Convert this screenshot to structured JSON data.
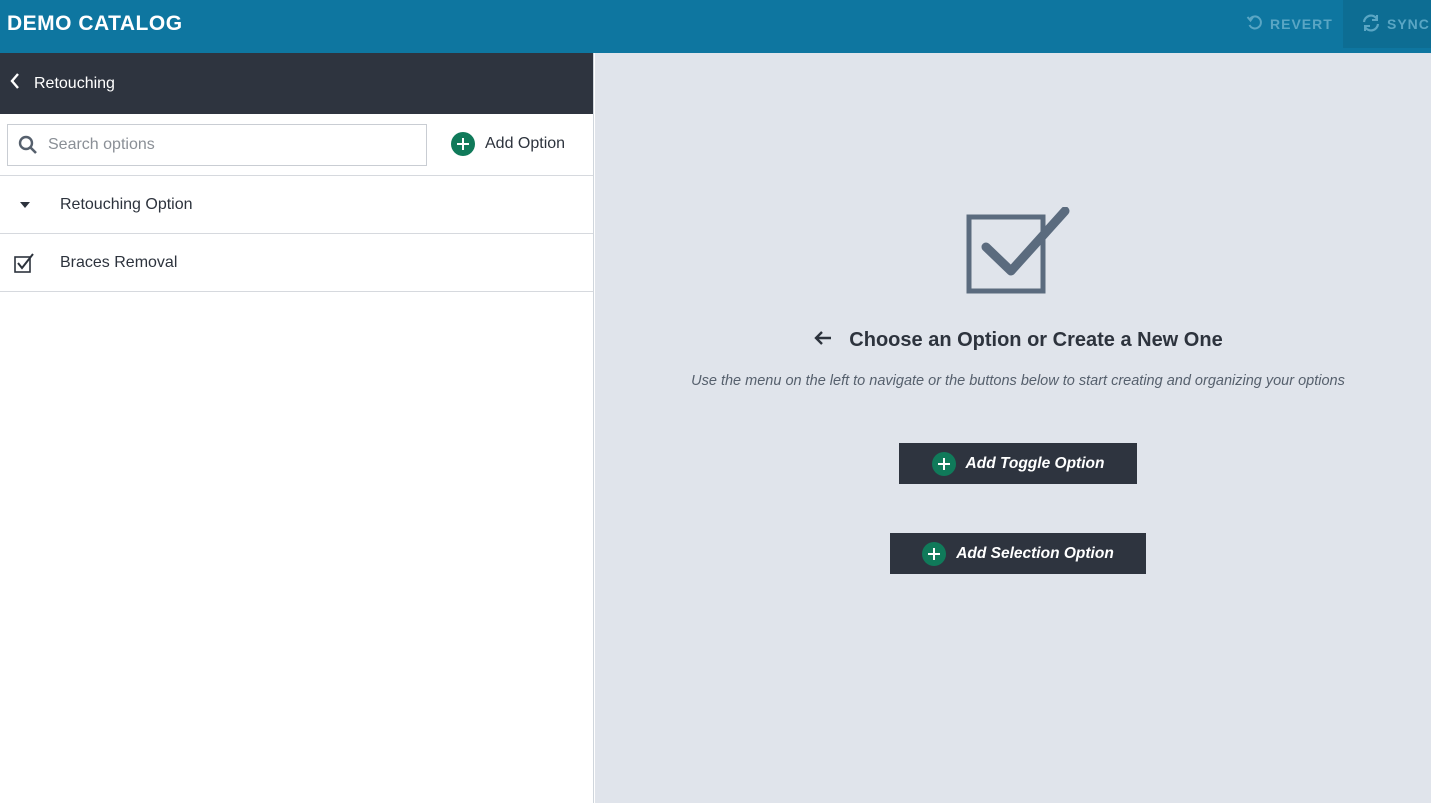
{
  "app": {
    "title": "DEMO CATALOG"
  },
  "topbar": {
    "revert_label": "REVERT",
    "sync_label": "SYNC"
  },
  "sidebar": {
    "title": "Retouching",
    "search": {
      "placeholder": "Search options",
      "value": ""
    },
    "add_option_label": "Add Option",
    "items": [
      {
        "label": "Retouching Option",
        "icon": "caret-down-icon"
      },
      {
        "label": "Braces Removal",
        "icon": "checkbox-checked-icon"
      }
    ]
  },
  "main": {
    "heading": "Choose an Option or Create a New One",
    "subtext": "Use the menu on the left to navigate or the buttons below to start creating and organizing your options",
    "buttons": {
      "toggle_label": "Add Toggle Option",
      "selection_label": "Add Selection Option"
    }
  },
  "colors": {
    "topbar": "#0e76a0",
    "sidebar_header": "#2e343f",
    "accent_green": "#107a5a",
    "main_bg": "#e0e4eb"
  }
}
